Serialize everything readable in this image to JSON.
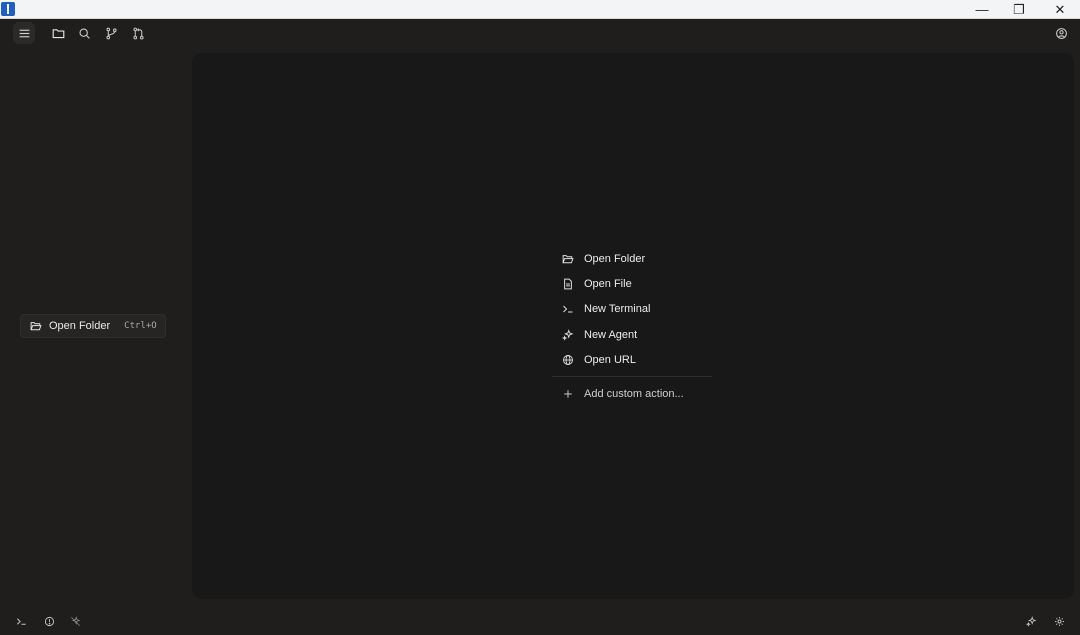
{
  "titlebar": {
    "minimize": "—",
    "restore": "❐",
    "close": "✕"
  },
  "toolbar": {
    "icons": [
      "menu-icon",
      "folder-icon",
      "search-icon",
      "source-control-icon",
      "pull-request-icon",
      "account-icon"
    ]
  },
  "sidebar": {
    "open_folder_label": "Open Folder",
    "open_folder_shortcut": "Ctrl+O"
  },
  "main": {
    "menu": [
      {
        "label": "Open Folder",
        "icon": "folder-open-icon"
      },
      {
        "label": "Open File",
        "icon": "file-icon"
      },
      {
        "label": "New Terminal",
        "icon": "terminal-icon"
      },
      {
        "label": "New Agent",
        "icon": "sparkle-icon"
      },
      {
        "label": "Open URL",
        "icon": "globe-icon"
      }
    ],
    "add_action": "Add custom action..."
  },
  "statusbar": {
    "icons": [
      "terminal-icon",
      "info-icon",
      "agent-off-icon",
      "sparkle-icon",
      "settings-icon"
    ]
  },
  "colors": {
    "background": "#1f1e1c",
    "panel": "#181818",
    "text": "#ececec"
  }
}
